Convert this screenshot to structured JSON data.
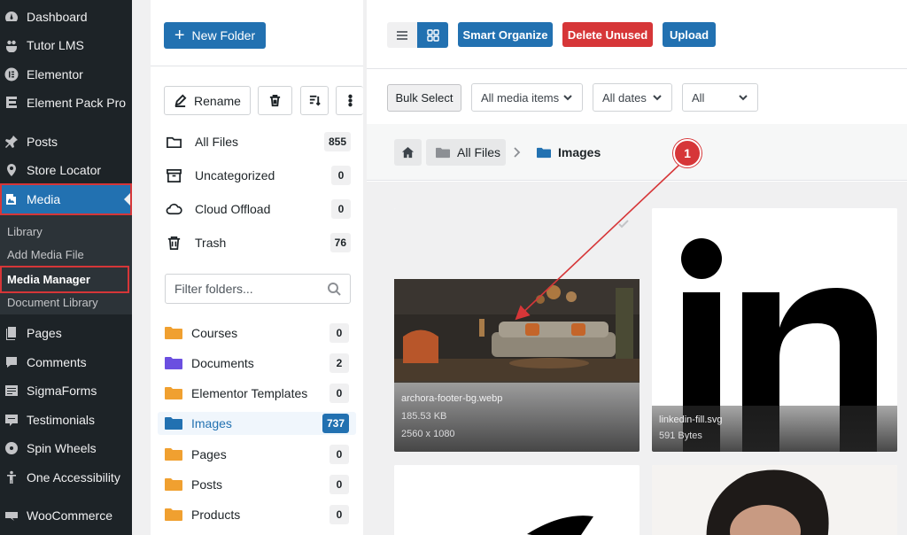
{
  "wp_menu": {
    "dashboard": "Dashboard",
    "tutor_lms": "Tutor LMS",
    "elementor": "Elementor",
    "element_pack_pro": "Element Pack Pro",
    "posts": "Posts",
    "store_locator": "Store Locator",
    "media": "Media",
    "pages": "Pages",
    "comments": "Comments",
    "sigmaforms": "SigmaForms",
    "testimonials": "Testimonials",
    "spin_wheels": "Spin Wheels",
    "one_accessibility": "One Accessibility",
    "woocommerce": "WooCommerce"
  },
  "media_submenu": {
    "library": "Library",
    "add_media_file": "Add Media File",
    "media_manager": "Media Manager",
    "document_library": "Document Library"
  },
  "folder_panel": {
    "new_folder_label": "New Folder",
    "rename_label": "Rename",
    "filter_placeholder": "Filter folders...",
    "root_items": [
      {
        "label": "All Files",
        "count": "855"
      },
      {
        "label": "Uncategorized",
        "count": "0"
      },
      {
        "label": "Cloud Offload",
        "count": "0"
      },
      {
        "label": "Trash",
        "count": "76"
      }
    ],
    "folders": [
      {
        "label": "Courses",
        "count": "0",
        "color": "#f0a030"
      },
      {
        "label": "Documents",
        "count": "2",
        "color": "#6b4fe0"
      },
      {
        "label": "Elementor Templates",
        "count": "0",
        "color": "#f0a030"
      },
      {
        "label": "Images",
        "count": "737",
        "color": "#2271b1"
      },
      {
        "label": "Pages",
        "count": "0",
        "color": "#f0a030"
      },
      {
        "label": "Posts",
        "count": "0",
        "color": "#f0a030"
      },
      {
        "label": "Products",
        "count": "0",
        "color": "#f0a030"
      }
    ]
  },
  "toolbar": {
    "smart_organize": "Smart Organize",
    "delete_unused": "Delete Unused",
    "upload": "Upload"
  },
  "filters": {
    "bulk_select": "Bulk Select",
    "media_type": "All media items",
    "dates": "All dates",
    "all": "All"
  },
  "breadcrumb": {
    "all_files": "All Files",
    "current": "Images"
  },
  "media_items": [
    {
      "name": "archora-footer-bg.webp",
      "size": "185.53 KB",
      "dimensions": "2560 x 1080"
    },
    {
      "name": "linkedin-fill.svg",
      "size": "591 Bytes"
    }
  ],
  "annotation": {
    "number": "1"
  },
  "colors": {
    "wp_sidebar": "#1d2327",
    "primary": "#2271b1",
    "danger": "#d63638",
    "folder_orange": "#f0a030",
    "folder_purple": "#6b4fe0"
  }
}
